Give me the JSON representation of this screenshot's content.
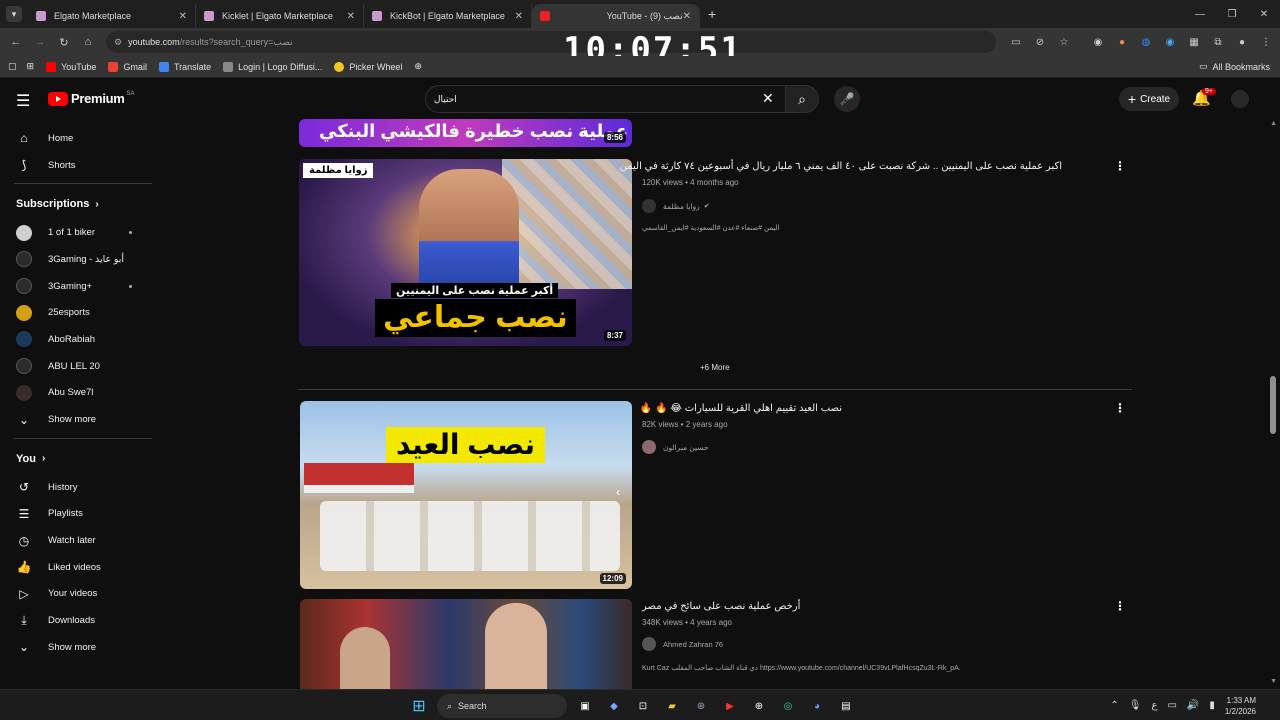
{
  "browser": {
    "tabs": [
      {
        "title": "Elgato Marketplace",
        "active": false
      },
      {
        "title": "Kicklet | Elgato Marketplace",
        "active": false
      },
      {
        "title": "KickBot | Elgato Marketplace",
        "active": false
      },
      {
        "title": "YouTube - نصب (9)",
        "active": true
      }
    ],
    "url_host": "youtube.com",
    "url_path": "/results?search_query=نصب",
    "bookmarks": [
      "YouTube",
      "Gmail",
      "Translate",
      "Login | Logo Diffusi...",
      "Picker Wheel"
    ],
    "all_bookmarks": "All Bookmarks"
  },
  "overlay_clock": "10:07:51",
  "yt": {
    "logo_text": "Premium",
    "logo_country": "SA",
    "search_value": "احتيال",
    "create_label": "Create",
    "notif_count": "9+"
  },
  "sidebar": {
    "home": "Home",
    "shorts": "Shorts",
    "subscriptions": "Subscriptions",
    "subs": [
      {
        "name": "1 of 1 biker",
        "dot": true,
        "color": "#cfcfcf"
      },
      {
        "name": "3Gaming - أبو عايد",
        "dot": false,
        "color": "#2b2b2b"
      },
      {
        "name": "3Gaming+",
        "dot": true,
        "color": "#2b2b2b"
      },
      {
        "name": "25esports",
        "dot": false,
        "color": "#d4a017"
      },
      {
        "name": "AboRabiah",
        "dot": false,
        "color": "#1e3a5a"
      },
      {
        "name": "ABU LEL 20",
        "dot": false,
        "color": "#2b2b2b"
      },
      {
        "name": "Abu Swe7l",
        "dot": false,
        "color": "#3a2a2a"
      }
    ],
    "show_more_1": "Show more",
    "you": "You",
    "you_items": [
      "History",
      "Playlists",
      "Watch later",
      "Liked videos",
      "Your videos",
      "Downloads"
    ],
    "show_more_2": "Show more"
  },
  "results": {
    "top_thumb_text": "عملية نصب خطيرة فالكيشي البنكي",
    "top_thumb_duration": "8:56",
    "videos": [
      {
        "title": "اكبر عملية نصب على اليمنيين .. شركة نصبت على ٤٠ الف يمني ٦ مليار ريال في أسبوعين ٧٤ كارثة في اليمن",
        "meta": "120K views • 4 months ago",
        "channel": "زوايا مظلمة",
        "verified": true,
        "desc": "اليمن #صنعاء #عدن #السعودية #ايمن_القاسمي",
        "duration": "8:37",
        "thumb_caption_1": "أكبر عملية نصب على اليمنيين",
        "thumb_caption_2": "نصب جماعي",
        "thumb_logo": "زوايا مظلمة"
      },
      {
        "title": "نصب العيد تقييم اهلي القرية للسيارات 😂 🔥 🔥",
        "meta": "82K views • 2 years ago",
        "channel": "حسين مبرالون",
        "verified": false,
        "desc": "",
        "duration": "12:09",
        "thumb_caption_1": "نصب العيد"
      },
      {
        "title": "أرخص عملية نصب على سائح في مصر",
        "meta": "348K views • 4 years ago",
        "channel": "Ahmed Zahran 76",
        "verified": false,
        "desc_prefix": "Kurt Caz",
        "desc_mid": "دي قناة الشاب صاحب المقلب",
        "desc_link": "https://www.youtube.com/channel/UC39vLPlafHcsqZu3L-Rk_pA.",
        "duration": ""
      }
    ],
    "more_label": "+6 More"
  },
  "taskbar": {
    "search": "Search",
    "time": "1:33 AM",
    "date": "1/2/2026"
  }
}
